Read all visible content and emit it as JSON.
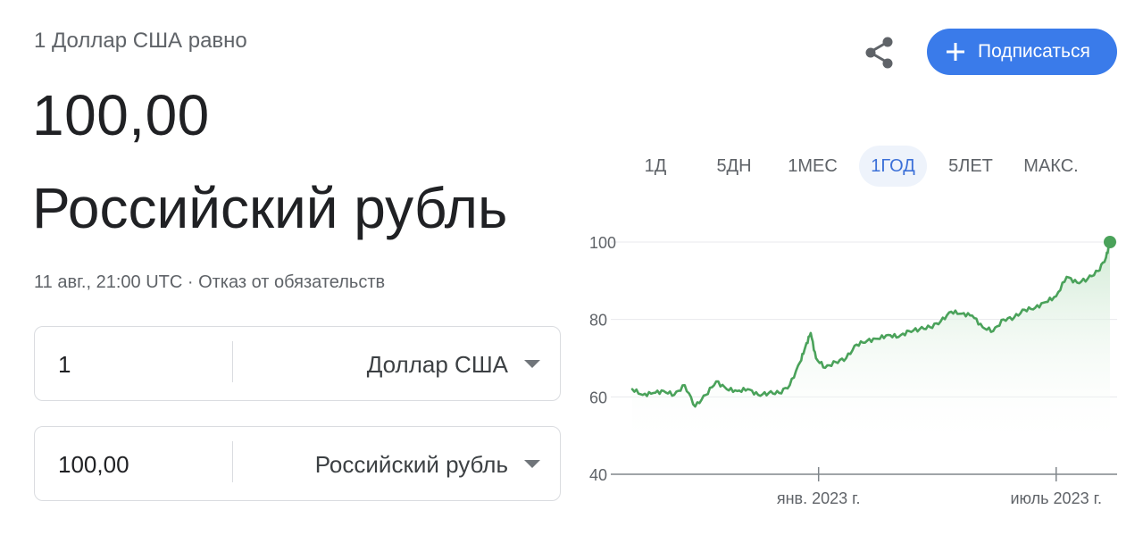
{
  "header": {
    "subtitle": "1 Доллар США равно",
    "value": "100,00",
    "currency_name": "Российский рубль",
    "timestamp": "11 авг., 21:00 UTC",
    "separator": " · ",
    "disclaimer": "Отказ от обязательств"
  },
  "converter": {
    "row1": {
      "amount": "1",
      "currency": "Доллар США"
    },
    "row2": {
      "amount": "100,00",
      "currency": "Российский рубль"
    }
  },
  "actions": {
    "share_icon": "share-icon",
    "subscribe_label": "Подписаться"
  },
  "range_tabs": [
    "1Д",
    "5ДН",
    "1МЕС",
    "1ГОД",
    "5ЛЕТ",
    "МАКС."
  ],
  "active_range": "1ГОД",
  "colors": {
    "accent": "#3a7bea",
    "line": "#4aa25a",
    "fill": "#e6f4e8",
    "grid": "#e8eaed",
    "text_secondary": "#5f6368"
  },
  "chart_data": {
    "type": "area",
    "ylim": [
      40,
      100
    ],
    "yticks": [
      "100",
      "80",
      "60",
      "40"
    ],
    "ytick_values": [
      100,
      80,
      60,
      40
    ],
    "xticks": [
      "янв. 2023 г.",
      "июль 2023 г."
    ],
    "xtick_values": [
      "2023-01-01",
      "2023-07-01"
    ],
    "grid": true,
    "x": [
      "2022-08-12",
      "2022-08-20",
      "2022-08-28",
      "2022-09-05",
      "2022-09-13",
      "2022-09-21",
      "2022-09-29",
      "2022-10-07",
      "2022-10-15",
      "2022-10-23",
      "2022-10-31",
      "2022-11-08",
      "2022-11-16",
      "2022-11-24",
      "2022-12-02",
      "2022-12-10",
      "2022-12-18",
      "2022-12-22",
      "2022-12-26",
      "2022-12-30",
      "2023-01-06",
      "2023-01-14",
      "2023-01-22",
      "2023-01-30",
      "2023-02-07",
      "2023-02-15",
      "2023-02-23",
      "2023-03-03",
      "2023-03-11",
      "2023-03-19",
      "2023-03-27",
      "2023-04-04",
      "2023-04-12",
      "2023-04-20",
      "2023-04-28",
      "2023-05-06",
      "2023-05-14",
      "2023-05-22",
      "2023-05-30",
      "2023-06-07",
      "2023-06-15",
      "2023-06-23",
      "2023-07-01",
      "2023-07-09",
      "2023-07-17",
      "2023-07-25",
      "2023-08-02",
      "2023-08-08",
      "2023-08-11"
    ],
    "values": [
      62,
      60.5,
      61,
      61.5,
      60.5,
      63,
      57.5,
      60.5,
      64,
      62,
      61.5,
      62,
      60.5,
      61,
      61,
      63,
      69,
      73,
      76.5,
      70,
      67.5,
      69,
      70,
      73.5,
      74.5,
      75,
      76,
      75.5,
      77,
      77.5,
      78,
      79.5,
      82,
      81.5,
      81,
      78,
      77,
      80,
      80.5,
      82.5,
      83,
      84.5,
      86,
      91,
      89.5,
      90.5,
      92.5,
      96,
      100
    ],
    "last_point": {
      "x": "2023-08-11",
      "y": 100
    }
  }
}
